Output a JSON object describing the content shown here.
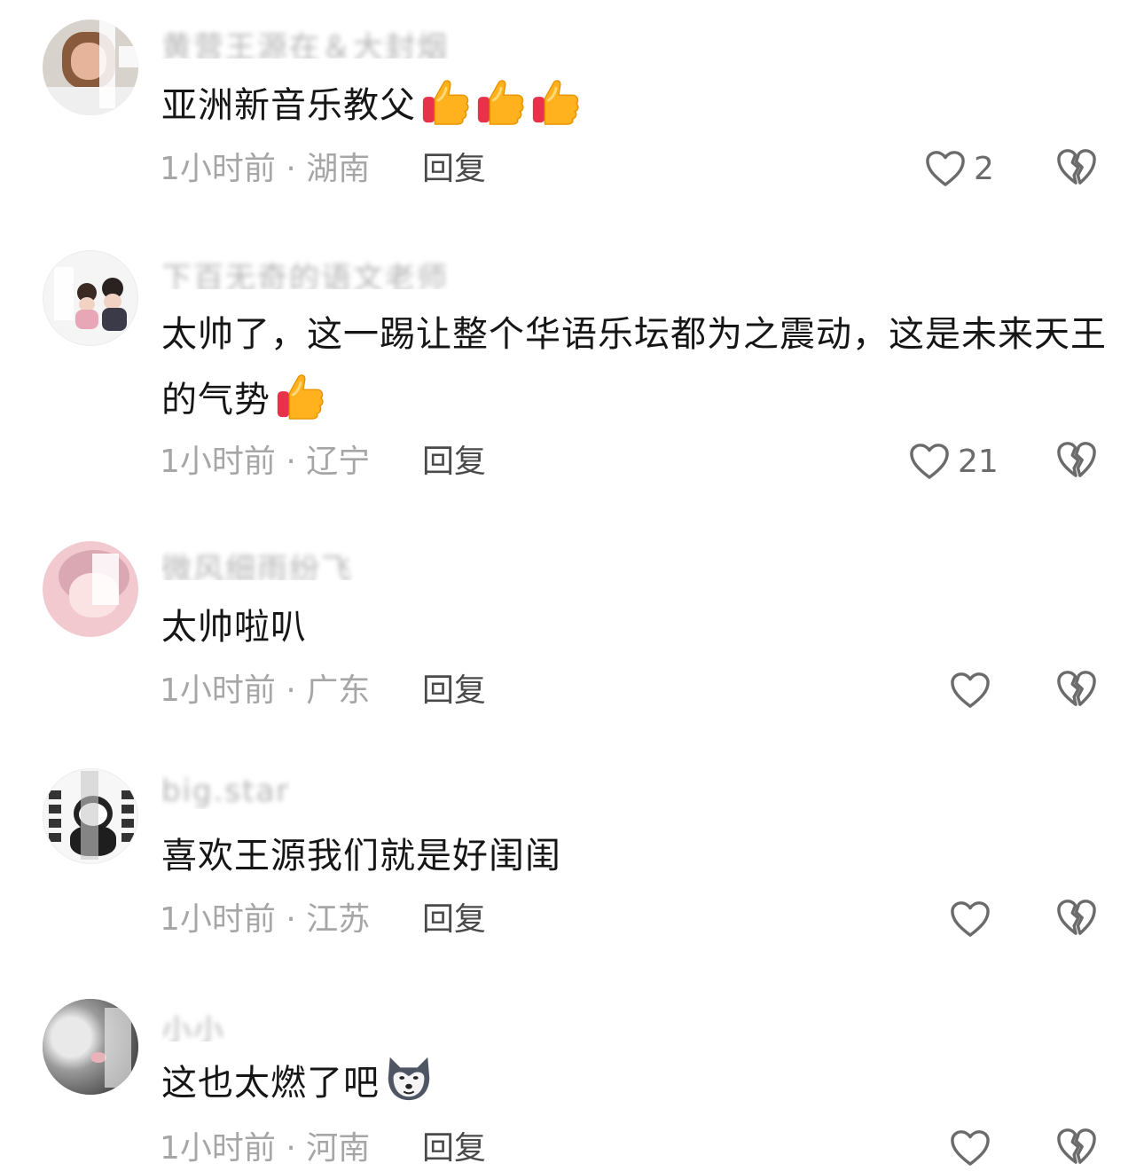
{
  "comments": [
    {
      "username": "黄营王源在＆大封烟",
      "text": "亚洲新音乐教父",
      "emojis": [
        "thumbs-up",
        "thumbs-up",
        "thumbs-up"
      ],
      "time": "1小时前",
      "location": "湖南",
      "meta": "1小时前 · 湖南",
      "reply_label": "回复",
      "likes": "2"
    },
    {
      "username": "下百无奇的语文老师",
      "text": "太帅了，这一踢让整个华语乐坛都为之震动，这是未来天王的气势",
      "emojis": [
        "thumbs-up"
      ],
      "time": "1小时前",
      "location": "辽宁",
      "meta": "1小时前 · 辽宁",
      "reply_label": "回复",
      "likes": "21"
    },
    {
      "username": "微风细雨纷飞",
      "text": "太帅啦叭",
      "emojis": [],
      "time": "1小时前",
      "location": "广东",
      "meta": "1小时前 · 广东",
      "reply_label": "回复",
      "likes": ""
    },
    {
      "username": "big.star",
      "text": "喜欢王源我们就是好闺闺",
      "emojis": [],
      "time": "1小时前",
      "location": "江苏",
      "meta": "1小时前 · 江苏",
      "reply_label": "回复",
      "likes": ""
    },
    {
      "username": "小小",
      "text": "这也太燃了吧",
      "emojis": [
        "husky-dog"
      ],
      "time": "1小时前",
      "location": "河南",
      "meta": "1小时前 · 河南",
      "reply_label": "回复",
      "likes": ""
    }
  ],
  "colors": {
    "text": "#161616",
    "meta": "#a6a6a6",
    "reply": "#4a4a4a",
    "icon": "#6b6b6b"
  },
  "icons": {
    "like": "heart-outline-icon",
    "dislike": "broken-heart-icon",
    "emoji_thumb": "thumbs-up-emoji",
    "emoji_dog": "husky-dog-emoji"
  }
}
